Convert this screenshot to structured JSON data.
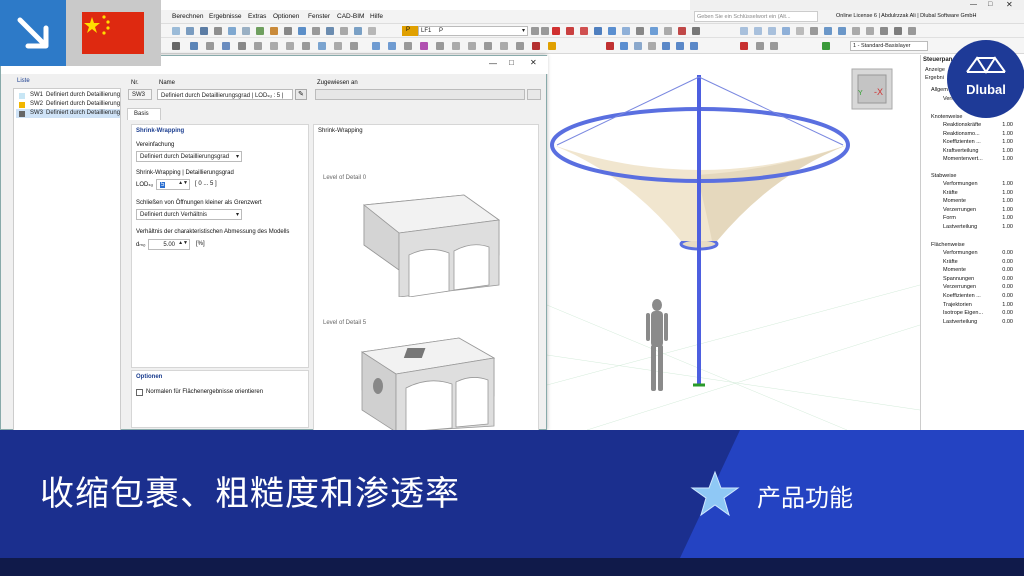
{
  "menu": {
    "items": [
      "Berechnen",
      "Ergebnisse",
      "Extras",
      "Optionen",
      "Fenster",
      "CAD-BIM",
      "Hilfe"
    ],
    "search_placeholder": "Geben Sie ein Schlüsselwort ein (Alt...",
    "license": "Online License 6 | Abdulrzzak Ali | Dlubal Software GmbH"
  },
  "toolbar": {
    "load_case_badge": "P",
    "load_case": "LF1",
    "load_case_name": "P",
    "layer": "1 - Standard-Basislayer"
  },
  "dialog": {
    "list_header": "Liste",
    "list_items": [
      {
        "id": "SW1",
        "label": "Definiert durch Detaillierung",
        "color": "#c8e6f5"
      },
      {
        "id": "SW2",
        "label": "Definiert durch Detaillierung",
        "color": "#f2b600"
      },
      {
        "id": "SW3",
        "label": "Definiert durch Detaillierung",
        "color": "#666666"
      }
    ],
    "nr_label": "Nr.",
    "nr_value": "SW3",
    "name_label": "Name",
    "name_value": "Definiert durch Detaillierungsgrad | LODₛᵤ : 5 |",
    "assigned_label": "Zugewiesen an",
    "tab_basis": "Basis",
    "section_shrink": "Shrink-Wrapping",
    "vereinfachung_label": "Vereinfachung",
    "vereinfachung_value": "Definiert durch Detaillierungsgrad",
    "lod_section": "Shrink-Wrapping | Detaillierungsgrad",
    "lod_label": "LODₛᵤ",
    "lod_value": "5",
    "lod_range": "[ 0 ... 5 ]",
    "close_openings_label": "Schließen von Öffnungen kleiner als Grenzwert",
    "close_openings_value": "Definiert durch Verhältnis",
    "ratio_label": "Verhältnis der charakteristischen Abmessung des Modells",
    "ratio_symbol": "dₘₒ",
    "ratio_value": "5.00",
    "ratio_unit": "[%]",
    "options_header": "Optionen",
    "options_checkbox": "Normalen für Flächenergebnisse orientieren",
    "preview_header": "Shrink-Wrapping",
    "lod0_label": "Level of Detail 0",
    "lod5_label": "Level of Detail 5"
  },
  "panel": {
    "header": "Steuerpan",
    "sub1": "Anzeige",
    "sub2": "Ergebni",
    "general_title": "Allgem",
    "general_row": "Verf",
    "node_title": "Knotenweise",
    "node_rows": [
      {
        "label": "Reaktionskräfte",
        "value": "1.00"
      },
      {
        "label": "Reaktionsmo...",
        "value": "1.00"
      },
      {
        "label": "Koeffizienten ...",
        "value": "1.00"
      },
      {
        "label": "Kraftverteilung",
        "value": "1.00"
      },
      {
        "label": "Momentenvert...",
        "value": "1.00"
      }
    ],
    "member_title": "Stabweise",
    "member_rows": [
      {
        "label": "Verformungen",
        "value": "1.00"
      },
      {
        "label": "Kräfte",
        "value": "1.00"
      },
      {
        "label": "Momente",
        "value": "1.00"
      },
      {
        "label": "Verzerrungen",
        "value": "1.00"
      },
      {
        "label": "Form",
        "value": "1.00"
      },
      {
        "label": "Lastverteilung",
        "value": "1.00"
      }
    ],
    "surface_title": "Flächenweise",
    "surface_rows": [
      {
        "label": "Verformungen",
        "value": "0.00"
      },
      {
        "label": "Kräfte",
        "value": "0.00"
      },
      {
        "label": "Momente",
        "value": "0.00"
      },
      {
        "label": "Spannungen",
        "value": "0.00"
      },
      {
        "label": "Verzerrungen",
        "value": "0.00"
      },
      {
        "label": "Koeffizienten ...",
        "value": "0.00"
      },
      {
        "label": "Trajektorien",
        "value": "1.00"
      },
      {
        "label": "Isotrope Eigen...",
        "value": "0.00"
      },
      {
        "label": "Lastverteilung",
        "value": "0.00"
      }
    ]
  },
  "brand": {
    "name": "Dlubal"
  },
  "banner": {
    "title": "收缩包裹、粗糙度和渗透率",
    "subtitle": "产品功能"
  }
}
